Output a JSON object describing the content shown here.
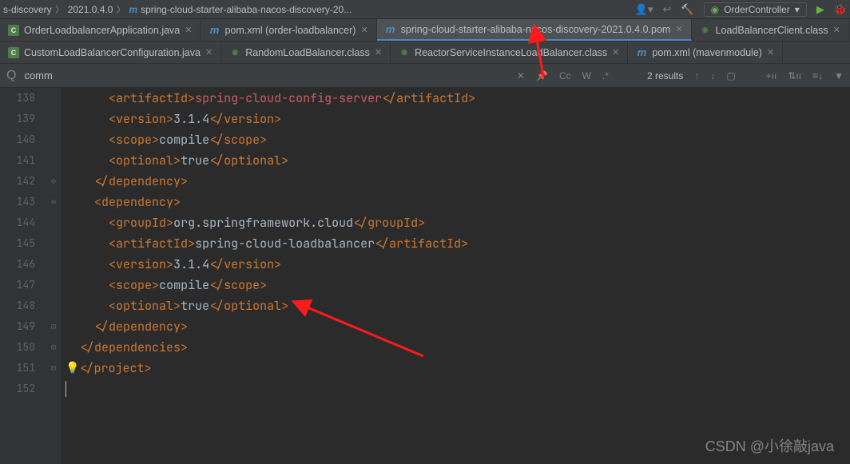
{
  "breadcrumb": {
    "p1": "s-discovery",
    "p2": "2021.0.4.0",
    "p3": "spring-cloud-starter-alibaba-nacos-discovery-20..."
  },
  "runConfig": {
    "label": "OrderController"
  },
  "tabsRow1": [
    {
      "icon": "c",
      "label": "OrderLoadbalancerApplication.java"
    },
    {
      "icon": "m",
      "label": "pom.xml (order-loadbalancer)"
    },
    {
      "icon": "m",
      "label": "spring-cloud-starter-alibaba-nacos-discovery-2021.0.4.0.pom",
      "active": true
    },
    {
      "icon": "j",
      "label": "LoadBalancerClient.class"
    }
  ],
  "tabsRow2": [
    {
      "icon": "c",
      "label": "CustomLoadBalancerConfiguration.java"
    },
    {
      "icon": "j",
      "label": "RandomLoadBalancer.class"
    },
    {
      "icon": "j",
      "label": "ReactorServiceInstanceLoadBalancer.class"
    },
    {
      "icon": "m",
      "label": "pom.xml (mavenmodule)"
    }
  ],
  "search": {
    "value": "comm",
    "results": "2 results",
    "opts": {
      "cc": "Cc",
      "w": "W",
      "regex": ".*",
      "up": "↑",
      "down": "↓",
      "sel": "▢",
      "add": "⊕",
      "plus": "+ıı",
      "pin": "⇅ıı",
      "sort": "≡↓",
      "filter": "▼"
    }
  },
  "lines": {
    "start": 138,
    "end": 152
  },
  "tokens": {
    "artifactId": "artifactId",
    "version": "version",
    "scope": "scope",
    "optional": "optional",
    "dependency": "dependency",
    "dependencies": "dependencies",
    "groupId": "groupId",
    "project": "project",
    "v_springConfig": "spring-cloud-config-server",
    "v_ver": "3.1.4",
    "v_compile": "compile",
    "v_true": "true",
    "v_group": "org.springframework.cloud",
    "v_lb": "spring-cloud-loadbalancer"
  },
  "watermark": "CSDN @小徐敲java"
}
